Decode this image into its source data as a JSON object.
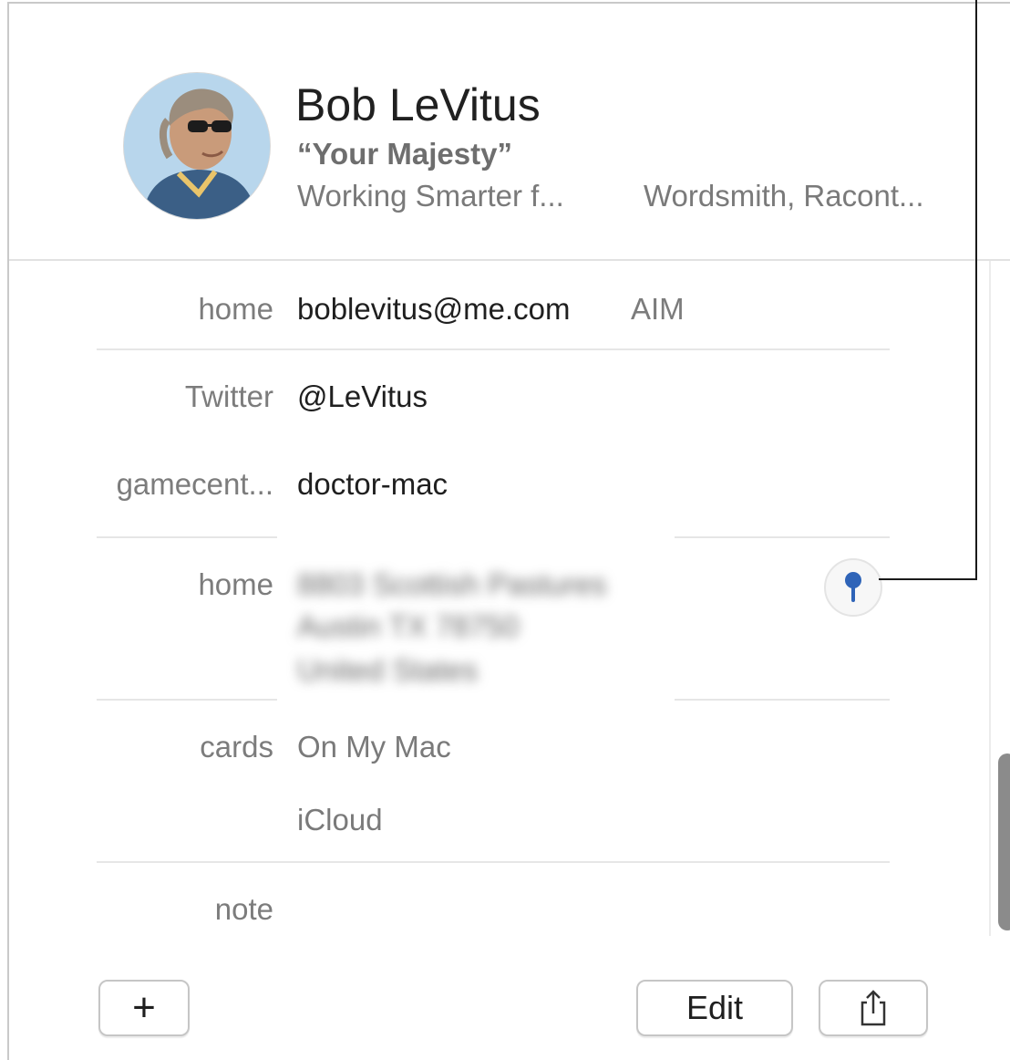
{
  "contact": {
    "name": "Bob LeVitus",
    "nickname": "“Your Majesty”",
    "company": "Working Smarter f...",
    "job_title": "Wordsmith, Racont..."
  },
  "fields": {
    "email": {
      "label": "home",
      "value": "boblevitus@me.com",
      "service": "AIM"
    },
    "twitter": {
      "label": "Twitter",
      "value": "@LeVitus"
    },
    "gamecenter": {
      "label": "gamecent...",
      "value": "doctor-mac"
    },
    "address": {
      "label": "home",
      "lines": [
        "8803 Scottish Pastures",
        "Austin TX 78750",
        "United States"
      ]
    },
    "cards": {
      "label": "cards",
      "values": [
        "On My Mac",
        "iCloud"
      ]
    },
    "note": {
      "label": "note"
    }
  },
  "toolbar": {
    "add_label": "+",
    "edit_label": "Edit",
    "share_icon": "share-icon"
  },
  "colors": {
    "pin": "#2f64b8",
    "label": "#7c7c7c",
    "scroll_thumb": "#8b8b8b"
  }
}
